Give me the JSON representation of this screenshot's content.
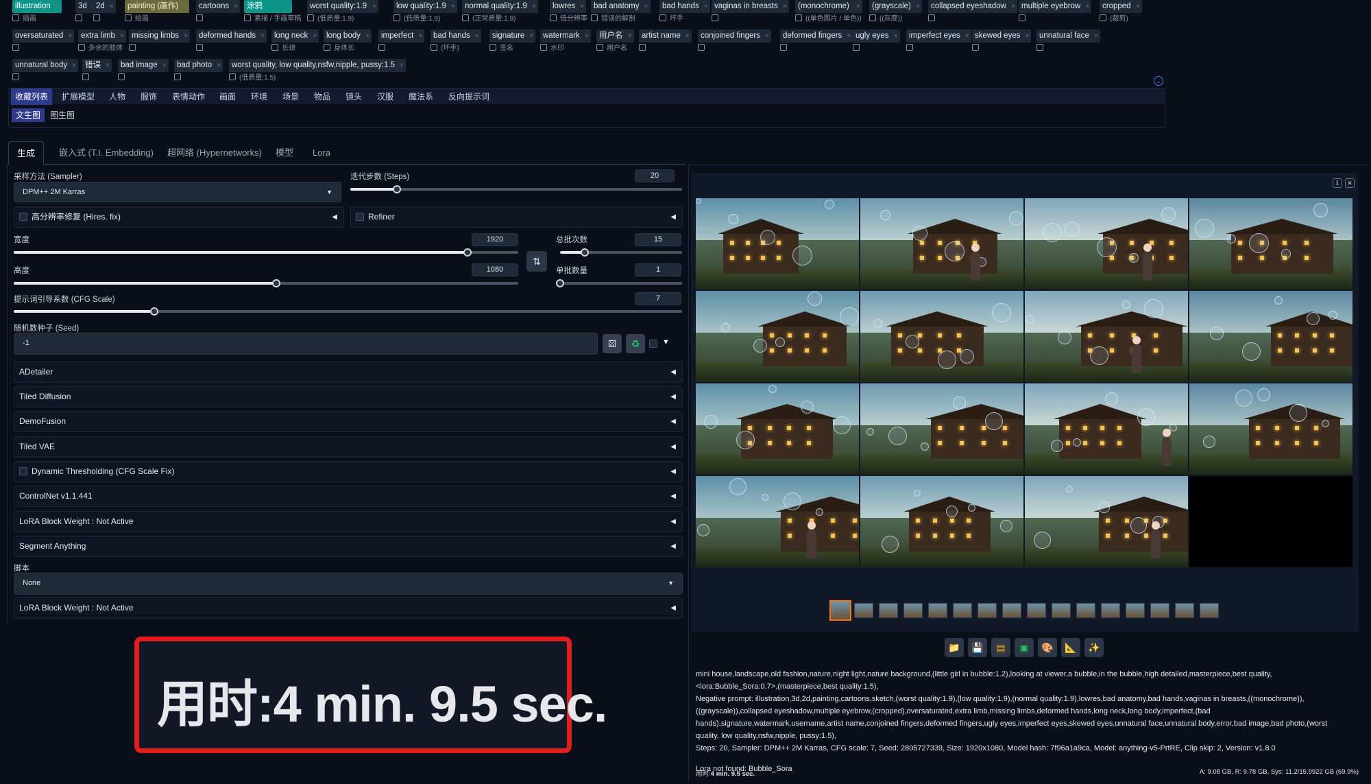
{
  "tags": {
    "row1": [
      {
        "label": "illustration",
        "sub": "插画",
        "style": "teal"
      },
      {
        "label": "3d",
        "sub": ""
      },
      {
        "label": "2d",
        "sub": ""
      },
      {
        "label": "painting (画作)",
        "sub": "绘画",
        "style": "olive"
      },
      {
        "label": "cartoons",
        "sub": ""
      },
      {
        "label": "涂鸦",
        "sub": "素描 / 手画草稿",
        "style": "teal"
      },
      {
        "label": "worst quality:1.9",
        "sub": "(低质量:1.9)"
      },
      {
        "label": "low quality:1.9",
        "sub": "(低质量:1.9)"
      },
      {
        "label": "normal quality:1.9",
        "sub": "(正常质量:1.9)"
      },
      {
        "label": "lowres",
        "sub": "低分辨率"
      },
      {
        "label": "bad anatomy",
        "sub": "错误的解剖"
      },
      {
        "label": "bad hands",
        "sub": "坏手"
      },
      {
        "label": "vaginas in breasts",
        "sub": ""
      },
      {
        "label": "(monochrome)",
        "sub": "((单色图片 / 单色))"
      },
      {
        "label": "(grayscale)",
        "sub": "((灰度))"
      },
      {
        "label": "collapsed eyeshadow",
        "sub": ""
      },
      {
        "label": "multiple eyebrow",
        "sub": ""
      },
      {
        "label": "cropped",
        "sub": "(裁剪)"
      }
    ],
    "row2": [
      {
        "label": "oversaturated",
        "sub": ""
      },
      {
        "label": "extra limb",
        "sub": "多余的肢体"
      },
      {
        "label": "missing limbs",
        "sub": ""
      },
      {
        "label": "deformed hands",
        "sub": ""
      },
      {
        "label": "long neck",
        "sub": "长颈"
      },
      {
        "label": "long body",
        "sub": "身体长"
      },
      {
        "label": "imperfect",
        "sub": ""
      },
      {
        "label": "bad hands",
        "sub": "(坏手)"
      },
      {
        "label": "signature",
        "sub": "签名"
      },
      {
        "label": "watermark",
        "sub": "水印"
      },
      {
        "label": "用户名",
        "sub": "用户名"
      },
      {
        "label": "artist name",
        "sub": ""
      },
      {
        "label": "conjoined fingers",
        "sub": ""
      },
      {
        "label": "deformed fingers",
        "sub": ""
      },
      {
        "label": "ugly eyes",
        "sub": ""
      },
      {
        "label": "imperfect eyes",
        "sub": ""
      },
      {
        "label": "skewed eyes",
        "sub": ""
      },
      {
        "label": "unnatural face",
        "sub": ""
      }
    ],
    "row3": [
      {
        "label": "unnatural body",
        "sub": ""
      },
      {
        "label": "错误",
        "sub": ""
      },
      {
        "label": "bad image",
        "sub": ""
      },
      {
        "label": "bad photo",
        "sub": ""
      },
      {
        "label": "worst quality, low quality,nsfw,nipple, pussy:1.5",
        "sub": "(低质量:1.5)"
      }
    ]
  },
  "categories": [
    "收藏列表",
    "扩展模型",
    "人物",
    "服饰",
    "表情动作",
    "画面",
    "环境",
    "场景",
    "物品",
    "镜头",
    "汉服",
    "魔法系",
    "反向提示词"
  ],
  "sub_tabs": [
    "文生图",
    "图生图"
  ],
  "main_tabs": [
    "生成",
    "嵌入式 (T.I. Embedding)",
    "超网络 (Hypernetworks)",
    "模型",
    "Lora"
  ],
  "sampler": {
    "label": "采样方法 (Sampler)",
    "value": "DPM++ 2M Karras"
  },
  "steps": {
    "label": "迭代步数 (Steps)",
    "value": "20",
    "fraction": 0.14
  },
  "hires": {
    "label": "高分辨率修复 (Hires. fix)"
  },
  "refiner": {
    "label": "Refiner"
  },
  "width": {
    "label": "宽度",
    "value": "1920",
    "fraction": 0.9
  },
  "height": {
    "label": "高度",
    "value": "1080",
    "fraction": 0.52
  },
  "batch_count": {
    "label": "总批次数",
    "value": "15",
    "fraction": 0.2
  },
  "batch_size": {
    "label": "单批数量",
    "value": "1",
    "fraction": 0.0
  },
  "cfg": {
    "label": "提示词引导系数 (CFG Scale)",
    "value": "7",
    "fraction": 0.21
  },
  "seed": {
    "label": "随机数种子 (Seed)",
    "value": "-1"
  },
  "accordions": [
    "ADetailer",
    "Tiled Diffusion",
    "DemoFusion",
    "Tiled VAE",
    "Dynamic Thresholding (CFG Scale Fix)",
    "ControlNet v1.1.441",
    "LoRA Block Weight : Not Active",
    "Segment Anything"
  ],
  "script": {
    "label": "脚本",
    "value": "None"
  },
  "lora_bottom": "LoRA Block Weight : Not Active",
  "timer_big": "用时:4 min. 9.5 sec.",
  "icons": {
    "gallery_download": "download-icon",
    "gallery_close": "close-icon",
    "seed_dice": "dice-icon",
    "seed_recycle": "recycle-icon",
    "tools": [
      "folder-icon",
      "save-icon",
      "zip-icon",
      "image-icon",
      "palette-icon",
      "ruler-icon",
      "sparkle-icon"
    ]
  },
  "info": {
    "prompt": "mini house,landscape,old fashion,nature,night light,nature background,(little girl in bubble:1.2),looking at viewer,a bubble,in the bubble,high detailed,masterpiece,best quality,<lora:Bubble_Sora:0.7>,(masterpiece,best quality:1.5),",
    "negative": "Negative prompt: illustration,3d,2d,painting,cartoons,sketch,(worst quality:1.9),(low quality:1.9),(normal quality:1.9),lowres,bad anatomy,bad hands,vaginas in breasts,((monochrome)),((grayscale)),collapsed eyeshadow,multiple eyebrow,(cropped),oversaturated,extra limb,missing limbs,deformed hands,long neck,long body,imperfect,(bad hands),signature,watermark,username,artist name,conjoined fingers,deformed fingers,ugly eyes,imperfect eyes,skewed eyes,unnatural face,unnatural body,error,bad image,bad photo,(worst quality, low quality,nsfw,nipple, pussy:1.5),",
    "params": "Steps: 20, Sampler: DPM++ 2M Karras, CFG scale: 7, Seed: 2805727339, Size: 1920x1080, Model hash: 7f96a1a9ca, Model: anything-v5-PrtRE, Clip skip: 2, Version: v1.8.0",
    "lora_warning": "Lora not found: Bubble_Sora"
  },
  "status": {
    "time_prefix": "用时:",
    "time_value": "4 min. 9.5 sec.",
    "vram": "A: 9.08 GB, R: 9.78 GB, Sys: 11.2/15.9922 GB (69.9%)"
  },
  "colors": {
    "accent": "#2e3a8c",
    "teal": "#0d9488",
    "highlight": "#e11d1d",
    "thumb_active": "#f97316"
  }
}
